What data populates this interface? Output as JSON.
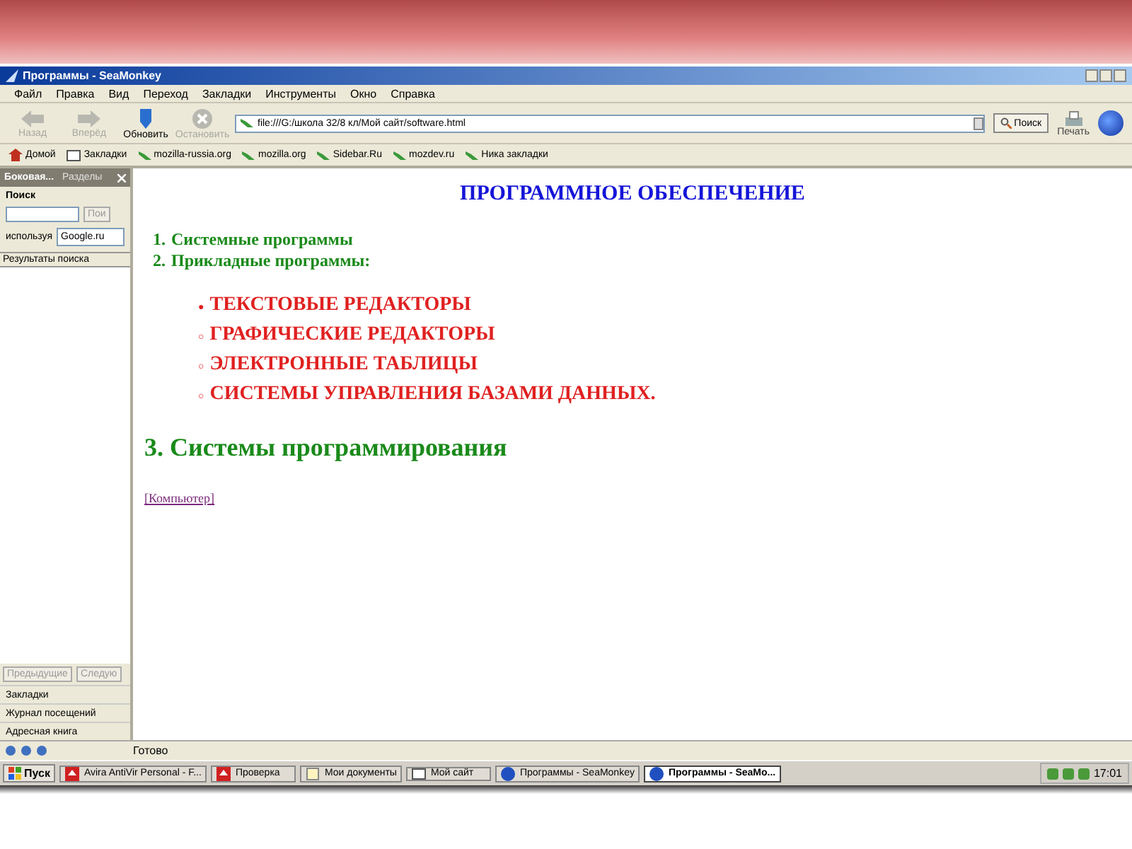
{
  "window": {
    "title": "Программы - SeaMonkey"
  },
  "menu": [
    "Файл",
    "Правка",
    "Вид",
    "Переход",
    "Закладки",
    "Инструменты",
    "Окно",
    "Справка"
  ],
  "toolbar": {
    "buttons": [
      {
        "label": "Назад",
        "kind": "back",
        "disabled": true
      },
      {
        "label": "Вперёд",
        "kind": "forward",
        "disabled": true
      },
      {
        "label": "Обновить",
        "kind": "reload",
        "disabled": false
      },
      {
        "label": "Остановить",
        "kind": "stop",
        "disabled": true
      }
    ],
    "address": "file:///G:/школа 32/8 кл/Мой сайт/software.html",
    "search_button": "Поиск",
    "print_button": "Печать"
  },
  "bookmarks": [
    {
      "label": "Домой",
      "kind": "home"
    },
    {
      "label": "Закладки",
      "kind": "folder"
    },
    {
      "label": "mozilla-russia.org",
      "kind": "link"
    },
    {
      "label": "mozilla.org",
      "kind": "link"
    },
    {
      "label": "Sidebar.Ru",
      "kind": "link"
    },
    {
      "label": "mozdev.ru",
      "kind": "link"
    },
    {
      "label": "Ника закладки",
      "kind": "link"
    }
  ],
  "sidebar": {
    "tabs": [
      {
        "label": "Боковая...",
        "selected": true
      },
      {
        "label": "Разделы",
        "selected": false
      }
    ],
    "panel_title": "Поиск",
    "search_button": "Пои",
    "engine_label": "используя",
    "engine": "Google.ru",
    "results_header": "Результаты поиска",
    "prev_button": "Предыдущие",
    "next_button": "Следую",
    "sections": [
      "Закладки",
      "Журнал посещений",
      "Адресная книга"
    ]
  },
  "page": {
    "heading": "ПРОГРАММНОЕ ОБЕСПЕЧЕНИЕ",
    "list": [
      {
        "number": "1.",
        "text": "Системные программы"
      },
      {
        "number": "2.",
        "text": "Прикладные программы:"
      }
    ],
    "sublist": [
      {
        "marker": "●",
        "text": "ТЕКСТОВЫЕ РЕДАКТОРЫ"
      },
      {
        "marker": "○",
        "text": "ГРАФИЧЕСКИЕ РЕДАКТОРЫ"
      },
      {
        "marker": "○",
        "text": "ЭЛЕКТРОННЫЕ ТАБЛИЦЫ"
      },
      {
        "marker": "○",
        "text": "СИСТЕМЫ УПРАВЛЕНИЯ БАЗАМИ ДАННЫХ."
      }
    ],
    "section": "3. Системы программирования",
    "link": "[Компьютер]"
  },
  "status_bar": {
    "text": "Готово"
  },
  "taskbar": {
    "start": "Пуск",
    "tasks": [
      {
        "label": "Avira AntiVir Personal - F...",
        "kind": "avira",
        "selected": false
      },
      {
        "label": "Проверка",
        "kind": "avira",
        "selected": false
      },
      {
        "label": "Мои документы",
        "kind": "document",
        "selected": false
      },
      {
        "label": "Мой сайт",
        "kind": "folder",
        "selected": false
      },
      {
        "label": "Программы - SeaMonkey",
        "kind": "browser",
        "selected": false
      },
      {
        "label": "Программы - SeaMo...",
        "kind": "browser",
        "selected": true
      }
    ],
    "clock": "17:01"
  }
}
